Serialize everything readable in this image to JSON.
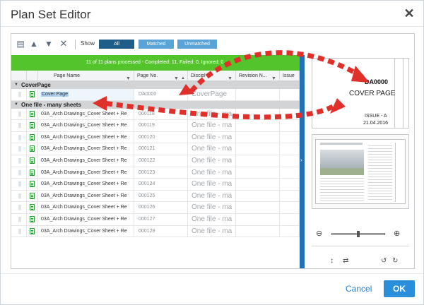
{
  "dialog": {
    "title": "Plan Set Editor",
    "close_icon": "close-icon"
  },
  "toolbar": {
    "icons": [
      "add-files-icon",
      "move-up-icon",
      "move-down-icon",
      "delete-icon"
    ],
    "show_label": "Show",
    "filters": {
      "all": "All",
      "matched": "Matched",
      "unmatched": "Unmatched"
    },
    "active_filter": "All"
  },
  "status": "11 of 11 plans processed - Completed: 11, Failed: 0, Ignored: 0.",
  "columns": {
    "page_name": "Page Name",
    "page_no": "Page No.",
    "discipline": "Discipl",
    "revision": "Revision N...",
    "issue": "Issue"
  },
  "groups": [
    {
      "label": "CoverPage",
      "rows": [
        {
          "name": "Cover Page",
          "no": "DA0000",
          "disc": "CoverPage"
        }
      ]
    },
    {
      "label": "One file - many sheets",
      "rows": [
        {
          "name": "03A_Arch Drawings_Cover Sheet + Re",
          "no": "000118",
          "disc": "One file - ma"
        },
        {
          "name": "03A_Arch Drawings_Cover Sheet + Re",
          "no": "000119",
          "disc": "One file - ma"
        },
        {
          "name": "03A_Arch Drawings_Cover Sheet + Re",
          "no": "000120",
          "disc": "One file - ma"
        },
        {
          "name": "03A_Arch Drawings_Cover Sheet + Re",
          "no": "000121",
          "disc": "One file - ma"
        },
        {
          "name": "03A_Arch Drawings_Cover Sheet + Re",
          "no": "000122",
          "disc": "One file - ma"
        },
        {
          "name": "03A_Arch Drawings_Cover Sheet + Re",
          "no": "000123",
          "disc": "One file - ma"
        },
        {
          "name": "03A_Arch Drawings_Cover Sheet + Re",
          "no": "000124",
          "disc": "One file - ma"
        },
        {
          "name": "03A_Arch Drawings_Cover Sheet + Re",
          "no": "000125",
          "disc": "One file - ma"
        },
        {
          "name": "03A_Arch Drawings_Cover Sheet + Re",
          "no": "000126",
          "disc": "One file - ma"
        },
        {
          "name": "03A_Arch Drawings_Cover Sheet + Re",
          "no": "000127",
          "disc": "One file - ma"
        },
        {
          "name": "03A_Arch Drawings_Cover Sheet + Re",
          "no": "000128",
          "disc": "One file - ma"
        }
      ]
    }
  ],
  "preview": {
    "code": "DA0000",
    "title": "COVER PAGE",
    "issue": "ISSUE - A",
    "date": "21.04.2016"
  },
  "colors": {
    "status_green": "#54c42c",
    "accent_blue": "#2a8fdb",
    "filter_active": "#1e5d87",
    "filter_inactive": "#5aa3d6",
    "annotation_red": "#e0302b"
  },
  "footer": {
    "cancel": "Cancel",
    "ok": "OK"
  }
}
